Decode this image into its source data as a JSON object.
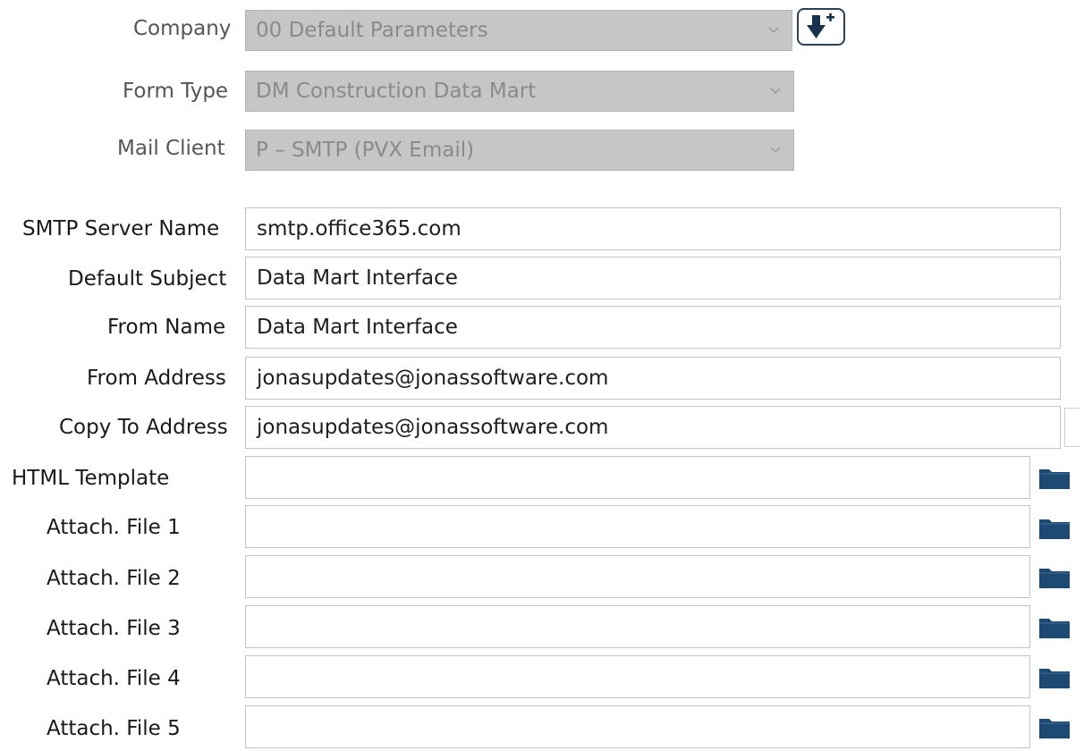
{
  "form": {
    "company": {
      "label": "Company",
      "value": "00 Default Parameters"
    },
    "form_type": {
      "label": "Form Type",
      "value": "DM Construction Data Mart"
    },
    "mail_client": {
      "label": "Mail Client",
      "value": "P – SMTP (PVX Email)"
    },
    "smtp_server_name": {
      "label": "SMTP Server Name",
      "value": "smtp.office365.com"
    },
    "default_subject": {
      "label": "Default Subject",
      "value": "Data Mart Interface"
    },
    "from_name": {
      "label": "From Name",
      "value": "Data Mart Interface"
    },
    "from_address": {
      "label": "From Address",
      "value": "jonasupdates@jonassoftware.com"
    },
    "copy_to_address": {
      "label": "Copy To Address",
      "value": "jonasupdates@jonassoftware.com"
    },
    "html_template": {
      "label": "HTML Template",
      "value": ""
    },
    "attach_file_1": {
      "label": "Attach. File 1",
      "value": ""
    },
    "attach_file_2": {
      "label": "Attach. File 2",
      "value": ""
    },
    "attach_file_3": {
      "label": "Attach. File 3",
      "value": ""
    },
    "attach_file_4": {
      "label": "Attach. File 4",
      "value": ""
    },
    "attach_file_5": {
      "label": "Attach. File 5",
      "value": ""
    }
  },
  "icons": {
    "company_lookup": "download-arrow-plus-icon",
    "file_browse": "folder-icon",
    "dropdown": "chevron-down-icon"
  },
  "colors": {
    "disabled_field_bg": "#c6c6c6",
    "disabled_text": "#8a8a8a",
    "muted_label": "#555555",
    "dark_label": "#1a1a1a",
    "folder_icon": "#1d4a73",
    "button_icon": "#16324c"
  }
}
